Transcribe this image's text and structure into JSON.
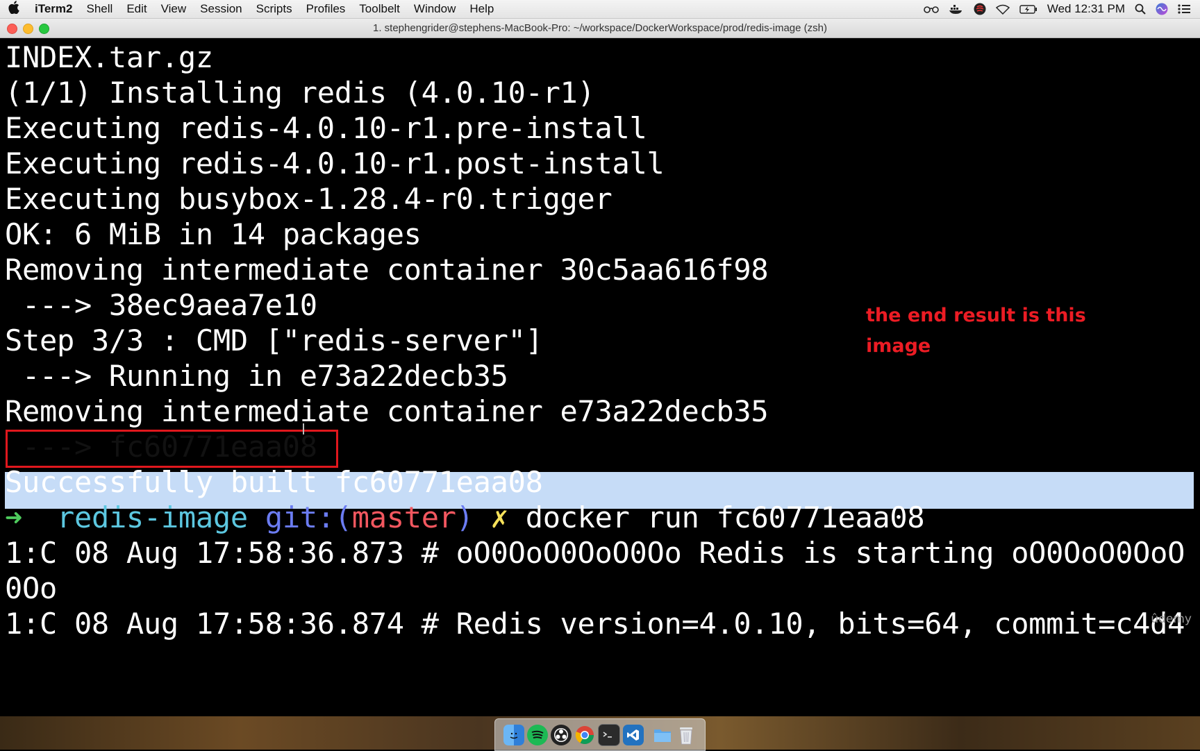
{
  "menubar": {
    "apple": "",
    "app_name": "iTerm2",
    "menus": [
      "Shell",
      "Edit",
      "View",
      "Session",
      "Scripts",
      "Profiles",
      "Toolbelt",
      "Window",
      "Help"
    ],
    "clock": "Wed 12:31 PM",
    "status_icons": [
      "glasses-icon",
      "docker-icon",
      "status-app-icon",
      "wifi-icon",
      "battery-icon",
      "search-icon",
      "siri-icon",
      "notification-center-icon"
    ]
  },
  "window": {
    "title": "1. stephengrider@stephens-MacBook-Pro: ~/workspace/DockerWorkspace/prod/redis-image (zsh)"
  },
  "terminal": {
    "lines": [
      "INDEX.tar.gz",
      "(1/1) Installing redis (4.0.10-r1)",
      "Executing redis-4.0.10-r1.pre-install",
      "Executing redis-4.0.10-r1.post-install",
      "Executing busybox-1.28.4-r0.trigger",
      "OK: 6 MiB in 14 packages",
      "Removing intermediate container 30c5aa616f98",
      " ---> 38ec9aea7e10",
      "Step 3/3 : CMD [\"redis-server\"]",
      " ---> Running in e73a22decb35",
      "Removing intermediate container e73a22decb35",
      " ---> fc60771eaa08",
      "Successfully built fc60771eaa08"
    ],
    "prompt": {
      "arrow": "➜",
      "dir": "redis-image",
      "git_label": "git:(",
      "branch": "master",
      "git_close": ")",
      "dirty": "✗",
      "command": "docker run fc60771eaa08"
    },
    "output_after": [
      "1:C 08 Aug 17:58:36.873 # oO0OoO0OoO0Oo Redis is starting oO0OoO0OoO",
      "0Oo",
      "1:C 08 Aug 17:58:36.874 # Redis version=4.0.10, bits=64, commit=c4d4"
    ]
  },
  "annotation": {
    "line1": "the end result is this",
    "line2": "image"
  },
  "watermark": "ûdemy",
  "colors": {
    "highlight": "#c6dcf7",
    "annotation": "#ec1c24",
    "prompt_arrow": "#4ecb5d"
  },
  "dock": {
    "icons": [
      "finder-icon",
      "spotify-icon",
      "obs-icon",
      "chrome-icon",
      "terminal-icon",
      "vscode-icon",
      "folder-icon",
      "trash-icon"
    ]
  }
}
